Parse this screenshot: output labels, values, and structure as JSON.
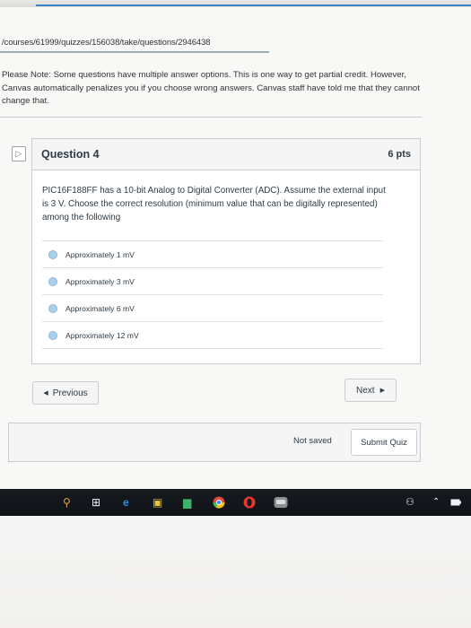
{
  "browser": {
    "url": "/courses/61999/quizzes/156038/take/questions/2946438"
  },
  "note": {
    "text": "Please Note: Some questions have multiple answer options. This is one way to get partial credit. However, Canvas automatically penalizes you if you choose wrong answers. Canvas staff have told me that they cannot change that."
  },
  "question": {
    "title": "Question 4",
    "points": "6 pts",
    "text": "PIC16F188FF has a 10-bit Analog to Digital Converter (ADC). Assume the external input is 3 V. Choose the correct resolution (minimum value that can be digitally represented) among the following",
    "answers": [
      {
        "label": "Approximately 1 mV"
      },
      {
        "label": "Approximately 3 mV"
      },
      {
        "label": "Approximately 6 mV"
      },
      {
        "label": "Approximately 12 mV"
      }
    ]
  },
  "nav": {
    "previous_label": "Previous",
    "next_label": "Next"
  },
  "footer": {
    "status": "Not saved",
    "submit_label": "Submit Quiz"
  },
  "taskbar": {
    "icons": [
      "search-icon",
      "task-view-icon",
      "edge-icon",
      "store-icon",
      "photos-icon",
      "chrome-icon",
      "opera-icon",
      "app-icon",
      "people-icon",
      "chevron-up-icon",
      "battery-icon"
    ]
  },
  "colors": {
    "accent": "#3a83c4",
    "radio": "#a9d1ec",
    "text": "#2d3b45",
    "taskbar": "#14181c"
  }
}
